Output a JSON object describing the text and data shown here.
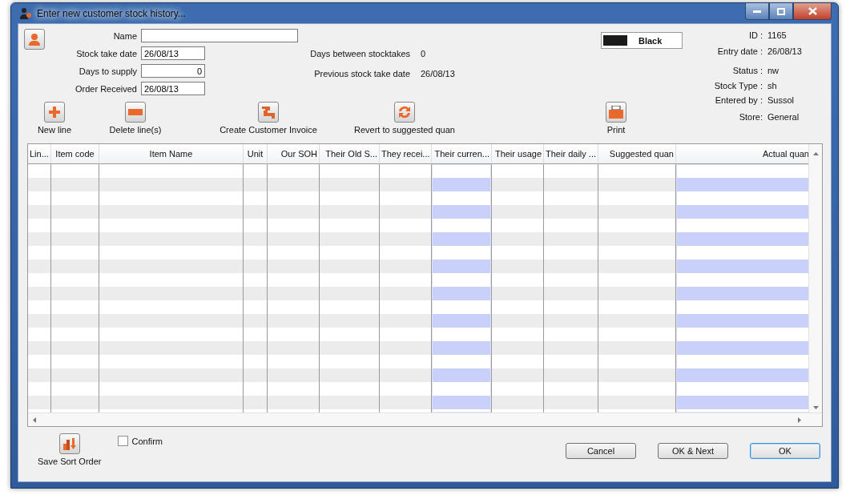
{
  "window": {
    "title": "Enter new customer stock history..."
  },
  "form": {
    "fields": [
      {
        "label": "Name",
        "kind": "wide"
      },
      {
        "label": "Stock take date",
        "value": "26/08/13",
        "kind": "date"
      },
      {
        "label": "Days to supply",
        "value": "0",
        "kind": "number"
      },
      {
        "label": "Order Received",
        "value": "26/08/13",
        "kind": "date"
      }
    ],
    "stats": [
      {
        "label": "Days between stocktakes",
        "value": "0"
      },
      {
        "label": "Previous stock take date",
        "value": "26/08/13"
      }
    ]
  },
  "color_swatch": {
    "label": "Black",
    "color": "#1a1a1a"
  },
  "info": [
    {
      "label": "ID :",
      "value": "1165"
    },
    {
      "label": "Entry date :",
      "value": "26/08/13"
    },
    {
      "label": "Status :",
      "value": "nw"
    },
    {
      "label": "Stock Type :",
      "value": "sh"
    },
    {
      "label": "Entered by :",
      "value": "Sussol"
    },
    {
      "label": "Store:",
      "value": "General"
    }
  ],
  "toolbar": [
    {
      "label": "New line",
      "kind": "add"
    },
    {
      "label": "Delete line(s)",
      "kind": "remove"
    },
    {
      "label": "Create Customer Invoice",
      "kind": "invoice"
    },
    {
      "label": "Revert to suggested quan",
      "kind": "revert"
    },
    {
      "label": "Print",
      "kind": "print"
    }
  ],
  "table": {
    "columns": [
      {
        "label": "Lin...",
        "editable": false
      },
      {
        "label": "Item code",
        "editable": false
      },
      {
        "label": "Item Name",
        "editable": false
      },
      {
        "label": "Unit",
        "editable": false
      },
      {
        "label": "Our SOH",
        "editable": false
      },
      {
        "label": "Their Old S...",
        "editable": false
      },
      {
        "label": "They recei...",
        "editable": false
      },
      {
        "label": "Their curren...",
        "editable": true
      },
      {
        "label": "Their usage",
        "editable": false
      },
      {
        "label": "Their daily ...",
        "editable": false
      },
      {
        "label": "Suggested quan",
        "editable": false
      },
      {
        "label": "Actual quan",
        "editable": true
      }
    ]
  },
  "save_sort": {
    "label": "Save Sort Order"
  },
  "confirm": {
    "label": "Confirm",
    "checked": false
  },
  "buttons": [
    {
      "label": "Cancel",
      "default": false
    },
    {
      "label": "OK & Next",
      "default": false
    },
    {
      "label": "OK",
      "default": true
    }
  ]
}
